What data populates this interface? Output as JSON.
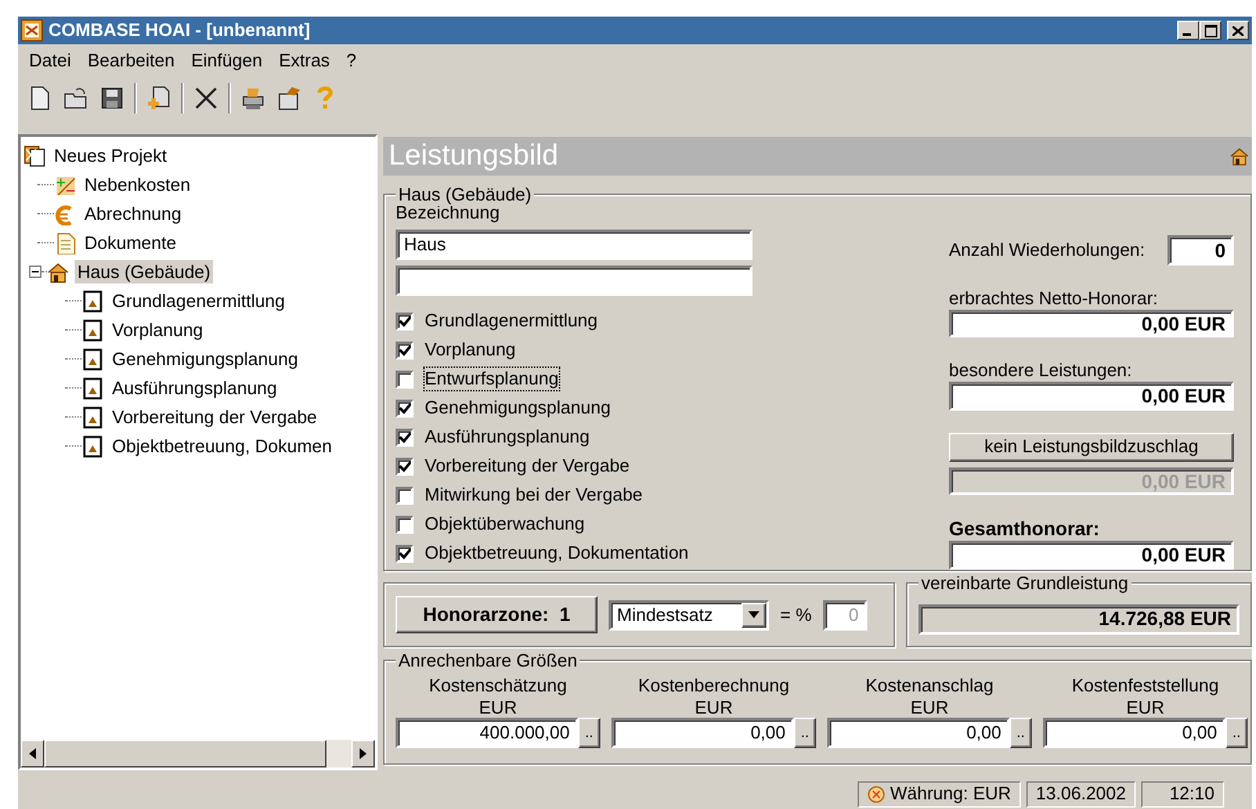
{
  "window": {
    "title": "COMBASE HOAI - [unbenannt]"
  },
  "menu": [
    "Datei",
    "Bearbeiten",
    "Einfügen",
    "Extras",
    "?"
  ],
  "tree": {
    "items": [
      {
        "label": "Neues Projekt",
        "kind": "project",
        "selected": false,
        "children": [
          {
            "label": "Nebenkosten",
            "kind": "costs",
            "selected": false
          },
          {
            "label": "Abrechnung",
            "kind": "billing",
            "selected": false
          },
          {
            "label": "Dokumente",
            "kind": "documents",
            "selected": false
          },
          {
            "label": "Haus (Gebäude)",
            "kind": "building",
            "selected": true,
            "expanded": true,
            "children": [
              {
                "label": "Grundlagenermittlung",
                "kind": "phase",
                "selected": false
              },
              {
                "label": "Vorplanung",
                "kind": "phase",
                "selected": false
              },
              {
                "label": "Genehmigungsplanung",
                "kind": "phase",
                "selected": false
              },
              {
                "label": "Ausführungsplanung",
                "kind": "phase",
                "selected": false
              },
              {
                "label": "Vorbereitung der Vergabe",
                "kind": "phase",
                "selected": false
              },
              {
                "label": "Objektbetreuung, Dokumen",
                "kind": "phase",
                "selected": false
              }
            ]
          }
        ]
      }
    ]
  },
  "panel": {
    "title": "Leistungsbild",
    "group": {
      "legend": "Haus (Gebäude)",
      "name_label": "Bezeichnung",
      "name_value": "Haus",
      "phases": [
        {
          "label": "Grundlagenermittlung",
          "checked": true,
          "focused": false
        },
        {
          "label": "Vorplanung",
          "checked": true,
          "focused": false
        },
        {
          "label": "Entwurfsplanung",
          "checked": false,
          "focused": true
        },
        {
          "label": "Genehmigungsplanung",
          "checked": true,
          "focused": false
        },
        {
          "label": "Ausführungsplanung",
          "checked": true,
          "focused": false
        },
        {
          "label": "Vorbereitung der Vergabe",
          "checked": true,
          "focused": false
        },
        {
          "label": "Mitwirkung bei der Vergabe",
          "checked": false,
          "focused": false
        },
        {
          "label": "Objektüberwachung",
          "checked": false,
          "focused": false
        },
        {
          "label": "Objektbetreuung, Dokumentation",
          "checked": true,
          "focused": false
        }
      ],
      "repeats": {
        "label": "Anzahl Wiederholungen:",
        "value": "0"
      },
      "net_fee": {
        "label": "erbrachtes Netto-Honorar:",
        "value": "0,00 EUR"
      },
      "special": {
        "label": "besondere Leistungen:",
        "value": "0,00 EUR"
      },
      "surcharge": {
        "button": "kein Leistungsbildzuschlag",
        "value": "0,00 EUR",
        "disabled": true
      },
      "total": {
        "label": "Gesamthonorar:",
        "value": "0,00 EUR"
      }
    },
    "zone": {
      "button": "Honorarzone:  1",
      "rate": "Mindestsatz",
      "percent_label": "= %",
      "percent_value": "0",
      "percent_disabled": true
    },
    "basic": {
      "legend": "vereinbarte Grundleistung",
      "value": "14.726,88 EUR"
    },
    "costs": {
      "legend": "Anrechenbare Größen",
      "columns": [
        {
          "label": "Kostenschätzung",
          "unit": "EUR",
          "value": "400.000,00",
          "button": ".."
        },
        {
          "label": "Kostenberechnung",
          "unit": "EUR",
          "value": "0,00",
          "button": ".."
        },
        {
          "label": "Kostenanschlag",
          "unit": "EUR",
          "value": "0,00",
          "button": ".."
        },
        {
          "label": "Kostenfeststellung",
          "unit": "EUR",
          "value": "0,00",
          "button": ".."
        }
      ]
    }
  },
  "status_bar": {
    "currency": "Währung: EUR",
    "date": "13.06.2002",
    "time": "12:10"
  }
}
